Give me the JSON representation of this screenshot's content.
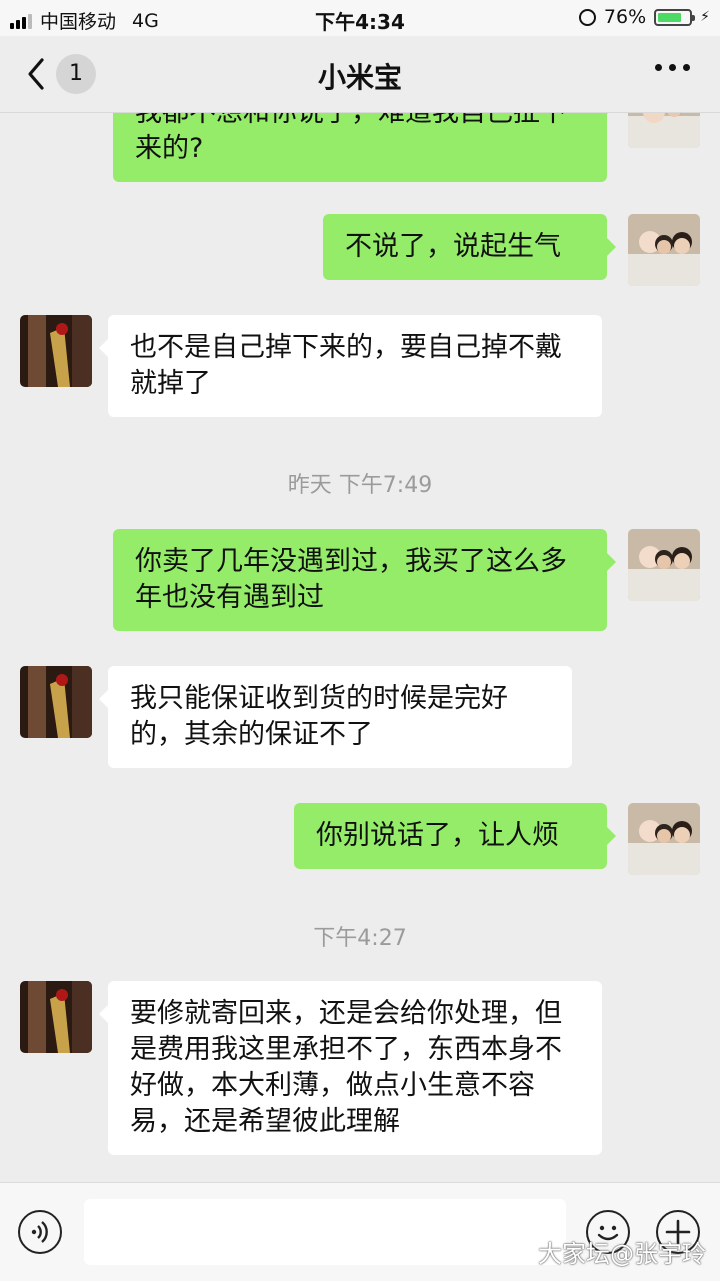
{
  "status_bar": {
    "carrier": "中国移动",
    "network": "4G",
    "time": "下午4:34",
    "battery_percent": "76%",
    "battery_level": 0.76
  },
  "nav": {
    "unread_count": "1",
    "title": "小米宝"
  },
  "messages": [
    {
      "sender": "me",
      "text": "我都不想和你说了，难道我自己扯下来的?"
    },
    {
      "sender": "me",
      "text": "不说了，说起生气"
    },
    {
      "sender": "other",
      "text": "也不是自己掉下来的，要自己掉不戴就掉了"
    },
    {
      "type": "timestamp",
      "text": "昨天 下午7:49"
    },
    {
      "sender": "me",
      "text": "你卖了几年没遇到过，我买了这么多年也没有遇到过"
    },
    {
      "sender": "other",
      "text": "我只能保证收到货的时候是完好的，其余的保证不了"
    },
    {
      "sender": "me",
      "text": "你别说话了，让人烦"
    },
    {
      "type": "timestamp",
      "text": "下午4:27"
    },
    {
      "sender": "other",
      "text": "要修就寄回来，还是会给你处理，但是费用我这里承担不了，东西本身不好做，本大利薄，做点小生意不容易，还是希望彼此理解"
    }
  ],
  "input_bar": {
    "value": ""
  },
  "watermark": "大家坛@张宇玲",
  "colors": {
    "my_bubble": "#95ec69",
    "their_bubble": "#ffffff",
    "background": "#ededed"
  }
}
